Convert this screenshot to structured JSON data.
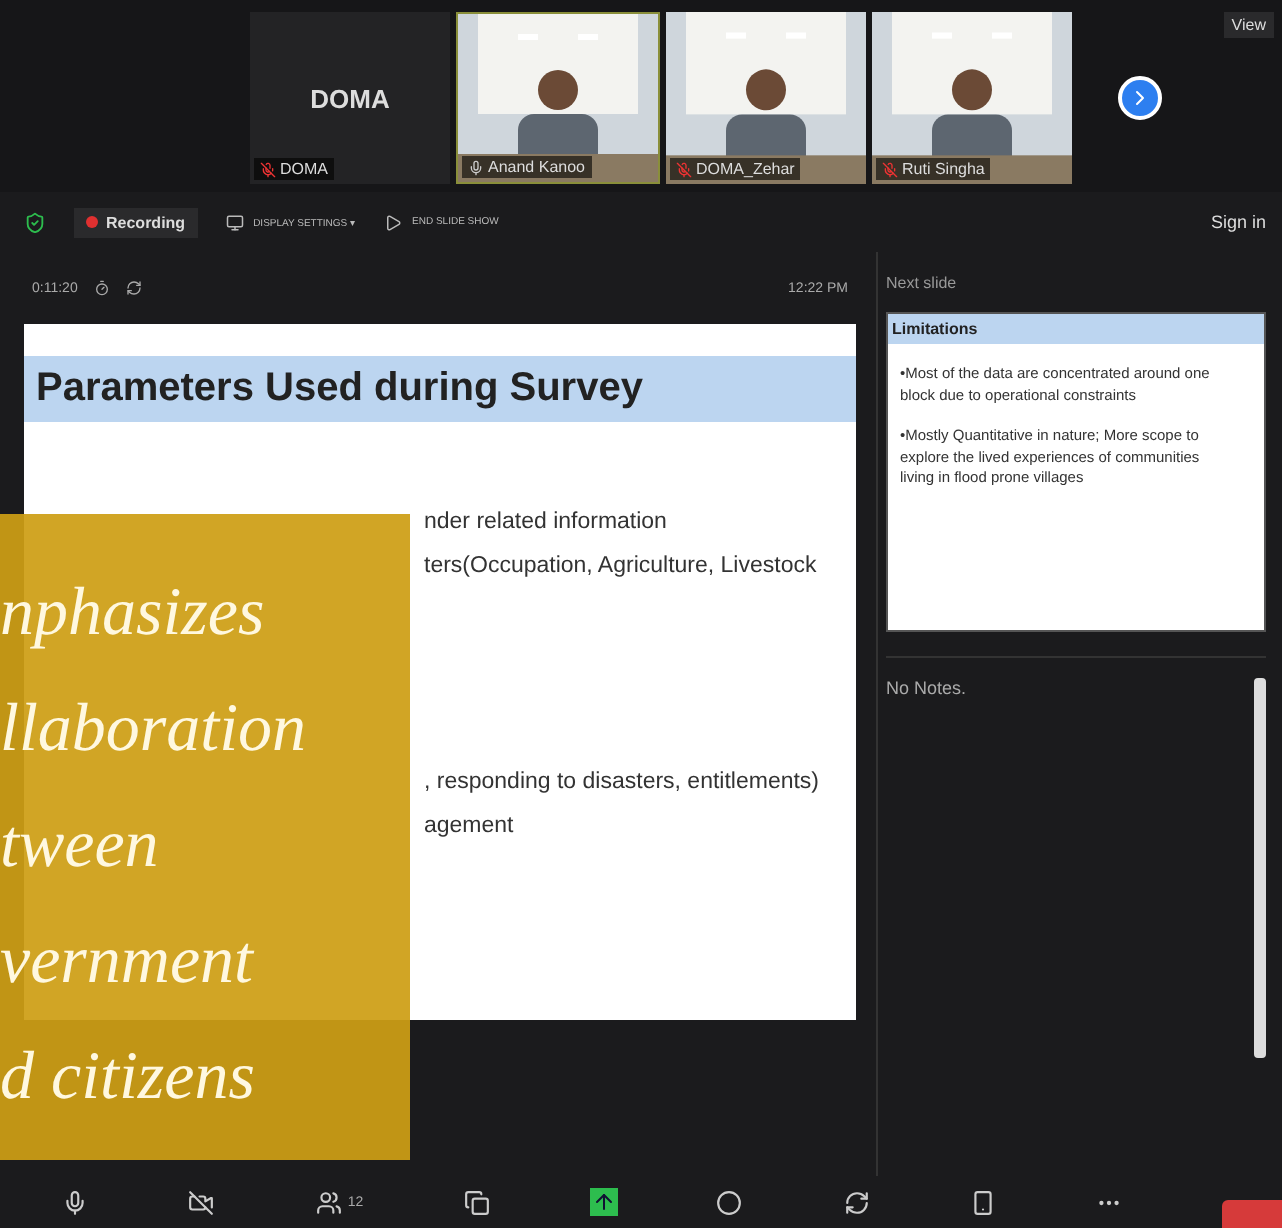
{
  "video_strip": {
    "tiles": [
      {
        "kind": "name",
        "big_name": "DOMA",
        "name": "DOMA",
        "muted": true
      },
      {
        "kind": "video",
        "name": "Anand Kanoo",
        "muted": false
      },
      {
        "kind": "video",
        "name": "DOMA_Zehar",
        "muted": true
      },
      {
        "kind": "video",
        "name": "Ruti Singha",
        "muted": true
      }
    ],
    "view_label": "View"
  },
  "controls": {
    "recording": "Recording",
    "display_settings": "DISPLAY SETTINGS ▾",
    "end_show": "END SLIDE SHOW",
    "sign_in": "Sign in"
  },
  "presenter": {
    "elapsed": "0:11:20",
    "clock": "12:22 PM",
    "slide": {
      "title": "Parameters Used during Survey",
      "bullets_upper": [
        "nder related information",
        "ters(Occupation, Agriculture, Livestock"
      ],
      "bullets_lower": [
        ", responding to disasters, entitlements)",
        "agement"
      ]
    },
    "next_slide_label": "Next slide",
    "next_slide": {
      "title": "Limitations",
      "bullets": [
        "•Most of the data are concentrated around one block due to operational constraints",
        "•Mostly Quantitative in nature; More scope to explore the lived experiences of communities living in flood prone villages"
      ]
    },
    "notes": "No Notes."
  },
  "toolbar": {
    "participants_count": "12"
  },
  "caption": {
    "lines": [
      "nphasizes",
      "llaboration",
      "tween",
      "vernment",
      "d citizens"
    ]
  }
}
